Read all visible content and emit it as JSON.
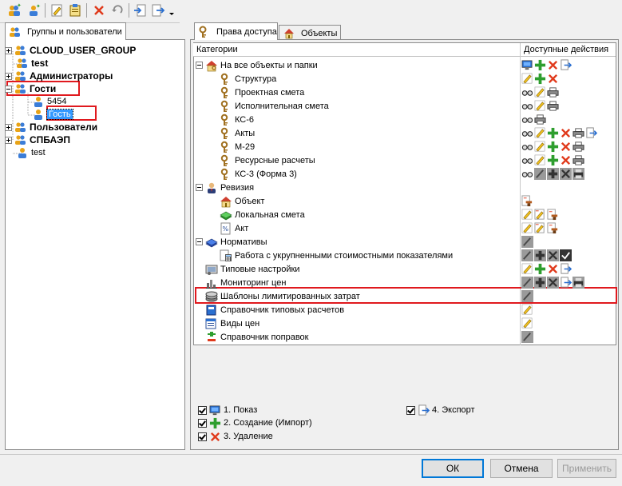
{
  "left_tab": {
    "label": "Группы и пользователи"
  },
  "right_tabs": [
    {
      "label": "Права доступа"
    },
    {
      "label": "Объекты"
    }
  ],
  "tree": [
    {
      "label": "CLOUD_USER_GROUP",
      "bold": true,
      "expander": "plus"
    },
    {
      "label": "test",
      "bold": true,
      "expander": "none"
    },
    {
      "label": "Администраторы",
      "bold": true,
      "expander": "plus"
    },
    {
      "label": "Гости",
      "bold": true,
      "expander": "minus"
    },
    {
      "label": "5454",
      "bold": false,
      "expander": "none"
    },
    {
      "label": "Гость",
      "bold": false,
      "expander": "none",
      "selected": true
    },
    {
      "label": "Пользователи",
      "bold": true,
      "expander": "plus"
    },
    {
      "label": "СПБАЭП",
      "bold": true,
      "expander": "plus"
    },
    {
      "label": "test",
      "bold": false,
      "expander": "none"
    }
  ],
  "table": {
    "col_categories": "Категории",
    "col_actions": "Доступные действия",
    "rows": [
      {
        "label": "На все объекты и папки",
        "level": 0,
        "icon": "house-key-icon",
        "expander": "minus",
        "actions": [
          "monitor",
          "plus",
          "x",
          "export"
        ]
      },
      {
        "label": "Структура",
        "level": 1,
        "icon": "key-icon",
        "actions": [
          "pencil",
          "plus",
          "x"
        ]
      },
      {
        "label": "Проектная смета",
        "level": 1,
        "icon": "key-icon",
        "actions": [
          "glasses",
          "pencil",
          "printer"
        ]
      },
      {
        "label": "Исполнительная смета",
        "level": 1,
        "icon": "key-icon",
        "actions": [
          "glasses",
          "pencil",
          "printer"
        ]
      },
      {
        "label": "КС-6",
        "level": 1,
        "icon": "key-icon",
        "actions": [
          "glasses",
          "printer"
        ]
      },
      {
        "label": "Акты",
        "level": 1,
        "icon": "key-icon",
        "actions": [
          "glasses",
          "pencil",
          "plus",
          "x",
          "printer",
          "export"
        ]
      },
      {
        "label": "М-29",
        "level": 1,
        "icon": "key-icon",
        "actions": [
          "glasses",
          "pencil",
          "plus",
          "x",
          "printer"
        ]
      },
      {
        "label": "Ресурсные расчеты",
        "level": 1,
        "icon": "key-icon",
        "actions": [
          "glasses",
          "pencil",
          "plus",
          "x",
          "printer"
        ]
      },
      {
        "label": "КС-3 (Форма 3)",
        "level": 1,
        "icon": "key-icon",
        "actions": [
          "glasses",
          "gray-pencil",
          "gray-plus",
          "gray-x",
          "gray-printer"
        ]
      },
      {
        "label": "Ревизия",
        "level": 0,
        "icon": "auditor-icon",
        "expander": "minus",
        "actions": []
      },
      {
        "label": "Объект",
        "level": 1,
        "icon": "house-icon",
        "actions": [
          "stamp-doc"
        ]
      },
      {
        "label": "Локальная смета",
        "level": 1,
        "icon": "green-book-icon",
        "actions": [
          "pencil",
          "pencil-doc",
          "stamp-doc"
        ]
      },
      {
        "label": "Акт",
        "level": 1,
        "icon": "percent-doc-icon",
        "actions": [
          "pencil",
          "pencil-doc",
          "stamp-doc"
        ]
      },
      {
        "label": "Нормативы",
        "level": 0,
        "icon": "blue-book-icon",
        "expander": "minus",
        "actions": [
          "gray-pencil"
        ]
      },
      {
        "label": "Работа с укрупненными стоимостными показателями",
        "level": 1,
        "icon": "calc-icon",
        "actions": [
          "gray-pencil",
          "gray-plus",
          "gray-x",
          "dark-check"
        ]
      },
      {
        "label": "Типовые настройки",
        "level": 0,
        "icon": "settings-icon",
        "actions": [
          "pencil",
          "plus",
          "x",
          "export"
        ]
      },
      {
        "label": "Мониторинг цен",
        "level": 0,
        "icon": "chart-icon",
        "actions": [
          "gray-pencil",
          "gray-plus",
          "gray-x",
          "export",
          "gray-printer"
        ]
      },
      {
        "label": "Шаблоны лимитированных затрат",
        "level": 0,
        "icon": "coins-icon",
        "actions": [
          "gray-pencil"
        ]
      },
      {
        "label": "Справочник типовых расчетов",
        "level": 0,
        "icon": "book-icon",
        "actions": [
          "pencil"
        ]
      },
      {
        "label": "Виды цен",
        "level": 0,
        "icon": "price-list-icon",
        "actions": [
          "pencil"
        ]
      },
      {
        "label": "Справочник поправок",
        "level": 0,
        "icon": "plusminus-icon",
        "actions": [
          "gray-pencil"
        ]
      }
    ]
  },
  "legend": [
    {
      "label": "1. Показ",
      "icon": "monitor"
    },
    {
      "label": "2. Создание (Импорт)",
      "icon": "plus"
    },
    {
      "label": "3. Удаление",
      "icon": "x"
    },
    {
      "label": "4. Экспорт",
      "icon": "export"
    }
  ],
  "buttons": {
    "ok": "ОК",
    "cancel": "Отмена",
    "apply": "Применить"
  },
  "colors": {
    "highlight": "#e0191e",
    "selection": "#3399ff",
    "plus": "#2e9e2e",
    "x": "#e03a1c"
  }
}
